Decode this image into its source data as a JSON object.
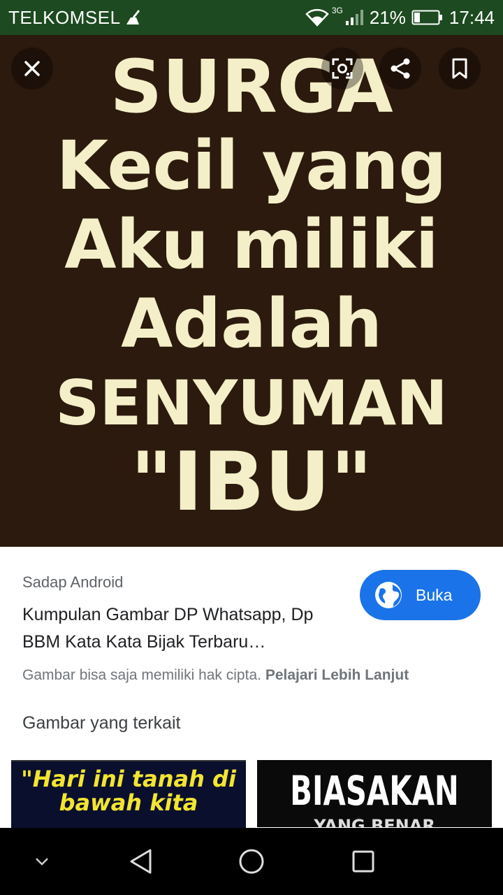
{
  "status_bar": {
    "carrier": "TELKOMSEL",
    "network": "3G",
    "battery": "21%",
    "time": "17:44"
  },
  "hero": {
    "lines": [
      "SURGA",
      "Kecil yang",
      "Aku miliki",
      "Adalah",
      "SENYUMAN",
      "\"IBU\""
    ],
    "background_color": "#2b1a0d",
    "text_color": "#f4efc8"
  },
  "toolbar": {
    "close_icon": "close-icon",
    "lens_icon": "lens-icon",
    "share_icon": "share-icon",
    "bookmark_icon": "bookmark-icon"
  },
  "result": {
    "source": "Sadap Android",
    "title": "Kumpulan Gambar DP Whatsapp, Dp BBM Kata Kata Bijak Terbaru…",
    "open_label": "Buka",
    "copyright_text": "Gambar bisa saja memiliki hak cipta.",
    "learn_more": "Pelajari Lebih Lanjut"
  },
  "related": {
    "title": "Gambar yang terkait",
    "thumbs": [
      {
        "text": "\"Hari ini tanah di bawah kita"
      },
      {
        "text": "BIASAKAN",
        "subtext": "YANG BENAR"
      }
    ]
  },
  "colors": {
    "status_bar": "#1d4a20",
    "accent": "#1a73e8"
  }
}
